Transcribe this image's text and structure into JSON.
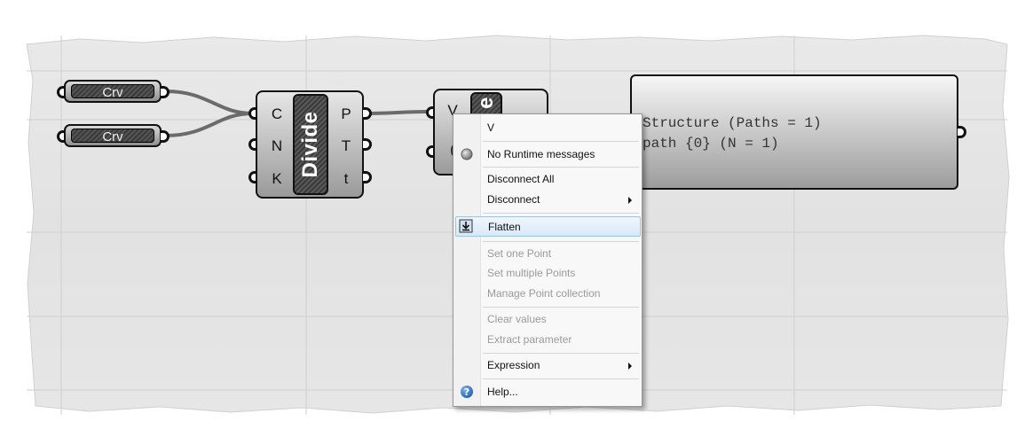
{
  "canvas": {
    "background_color": "#ffffff",
    "grid_color": "#cfcfcf"
  },
  "nodes": {
    "crv_param_1": {
      "label": "Crv"
    },
    "crv_param_2": {
      "label": "Crv"
    },
    "divide_component": {
      "title": "Divide",
      "inputs": [
        "C",
        "N",
        "K"
      ],
      "outputs": [
        "P",
        "T",
        "t"
      ]
    },
    "vector_component": {
      "inputs": [
        "V",
        "("
      ],
      "title": "e"
    },
    "panel": {
      "lines": [
        "Structure (Paths = 1)",
        "path {0} (N = 1)"
      ]
    }
  },
  "context_menu": {
    "header": "V",
    "items": [
      {
        "label": "No Runtime messages",
        "icon": "gray-dot-icon",
        "enabled": true
      },
      {
        "label": "Disconnect All",
        "enabled": true
      },
      {
        "label": "Disconnect",
        "enabled": true,
        "submenu": true
      },
      {
        "label": "Flatten",
        "icon": "flatten-icon",
        "enabled": true,
        "highlighted": true
      },
      {
        "label": "Set one Point",
        "enabled": false
      },
      {
        "label": "Set multiple Points",
        "enabled": false
      },
      {
        "label": "Manage Point collection",
        "enabled": false
      },
      {
        "label": "Clear values",
        "enabled": false
      },
      {
        "label": "Extract parameter",
        "enabled": false
      },
      {
        "label": "Expression",
        "enabled": true,
        "submenu": true
      },
      {
        "label": "Help...",
        "icon": "help-icon",
        "enabled": true
      }
    ],
    "highlight_color": "#d9e8f7"
  }
}
